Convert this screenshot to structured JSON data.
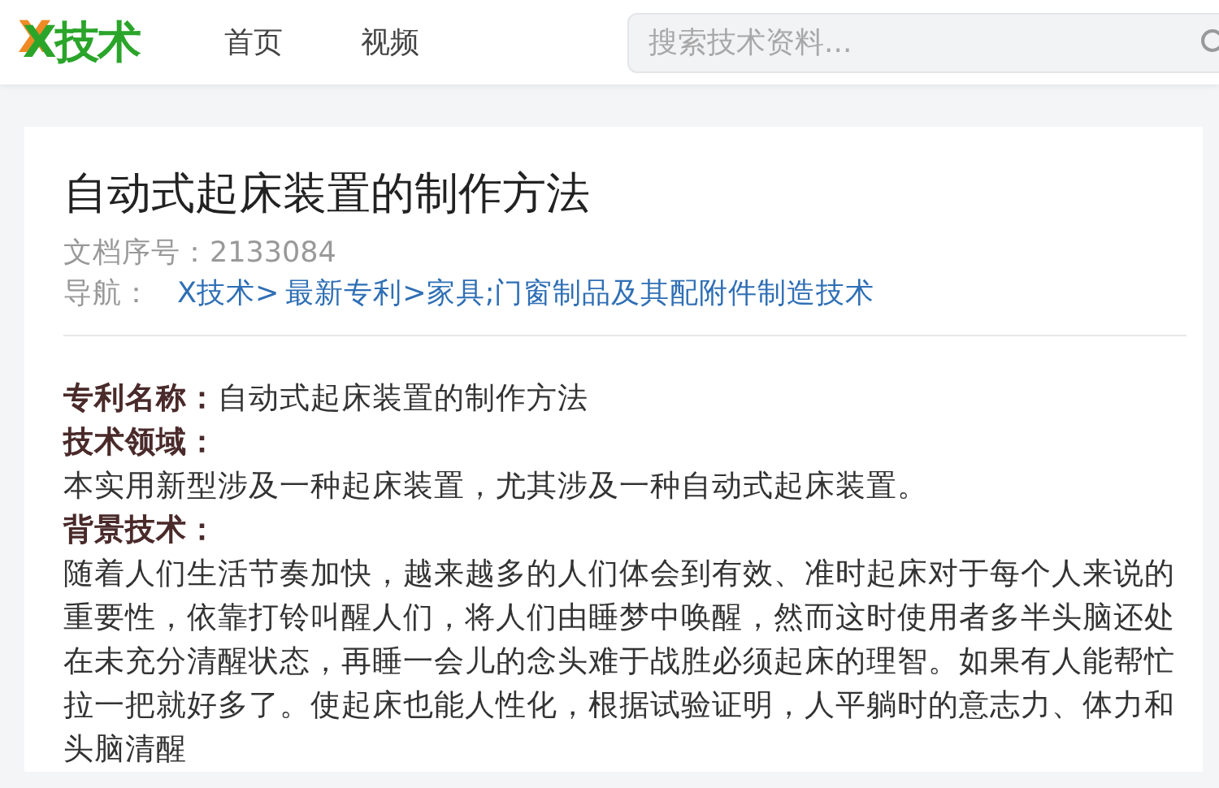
{
  "header": {
    "logo": {
      "mark": "X",
      "text": "技术"
    },
    "nav": [
      {
        "label": "首页",
        "selected": false
      },
      {
        "label": "视频",
        "selected": false
      }
    ],
    "search": {
      "placeholder": "搜索技术资料..."
    }
  },
  "article": {
    "title": "自动式起床装置的制作方法",
    "doc_number": {
      "label": "文档序号：",
      "value": "2133084"
    },
    "breadcrumb": {
      "label": "导航：",
      "links": [
        "X技术>",
        "最新专利>家具;门窗制品及其配附件制造技术"
      ]
    },
    "sections": [
      {
        "kind": "field",
        "label": "专利名称：",
        "text": "自动式起床装置的制作方法"
      },
      {
        "kind": "heading",
        "label": "技术领域："
      },
      {
        "kind": "paragraph",
        "text": "本实用新型涉及一种起床装置，尤其涉及一种自动式起床装置。"
      },
      {
        "kind": "heading",
        "label": "背景技术："
      },
      {
        "kind": "paragraph",
        "text": "随着人们生活节奏加快，越来越多的人们体会到有效、准时起床对于每个人来说的重要性，依靠打铃叫醒人们，将人们由睡梦中唤醒，然而这时使用者多半头脑还处在未充分清醒状态，再睡一会儿的念头难于战胜必须起床的理智。如果有人能帮忙拉一把就好多了。使起床也能人性化，根据试验证明，人平躺时的意志力、体力和头脑清醒"
      }
    ]
  }
}
